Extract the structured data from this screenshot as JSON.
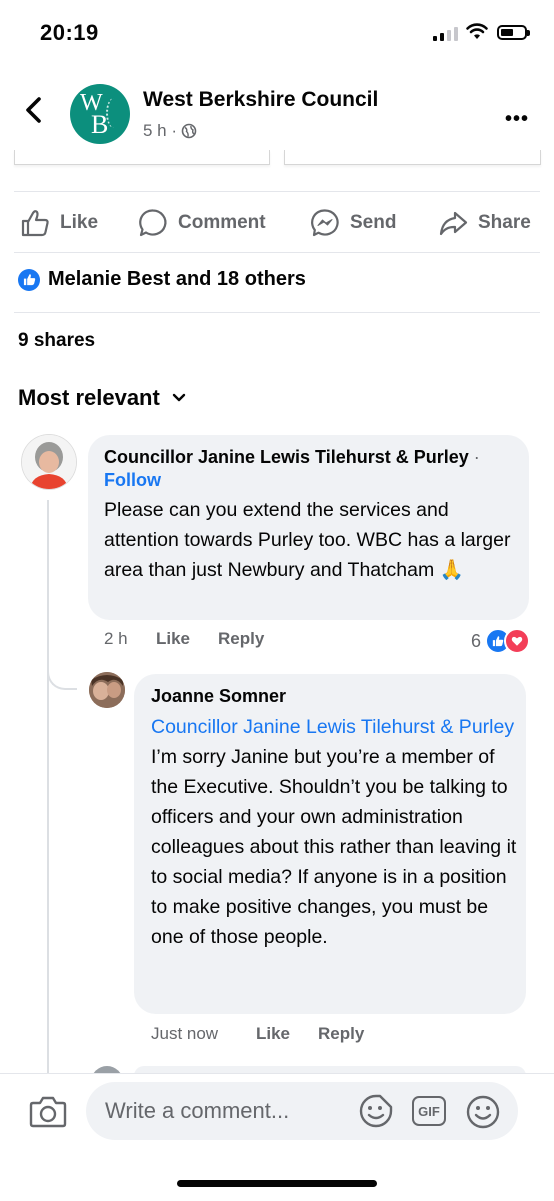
{
  "status": {
    "time": "20:19"
  },
  "header": {
    "page_name": "West Berkshire Council",
    "post_time": "5 h ·",
    "logo_letters": "WB"
  },
  "actions": {
    "like": "Like",
    "comment": "Comment",
    "send": "Send",
    "share": "Share"
  },
  "reactions_summary": "Melanie Best and 18 others",
  "shares": "9 shares",
  "sort_label": "Most relevant",
  "comments": [
    {
      "author": "Councillor Janine Lewis Tilehurst & Purley",
      "dot": "·",
      "follow": "Follow",
      "text": "Please can you extend the services and attention towards Purley too. WBC has a larger area than just Newbury and Thatcham 🙏",
      "time": "2 h",
      "like": "Like",
      "reply": "Reply",
      "reaction_count": "6"
    },
    {
      "author": "Joanne Somner",
      "mention": "Councillor Janine Lewis Tilehurst & Purley",
      "text": " I’m sorry Janine but you’re a member of the Executive. Shouldn’t you be talking to officers and your own administration colleagues about this rather than leaving it to social media? If anyone is in a position to make positive changes, you must be one of those people.",
      "time": "Just now",
      "like": "Like",
      "reply": "Reply"
    }
  ],
  "composer": {
    "placeholder": "Write a comment...",
    "gif": "GIF"
  },
  "colors": {
    "brand_blue": "#1877f2",
    "logo_teal": "#0c8f7d",
    "love_red": "#f33e58",
    "muted": "#65676b"
  },
  "icons": [
    "back-arrow-icon",
    "globe-icon",
    "more-icon",
    "like-icon",
    "comment-icon",
    "messenger-icon",
    "share-icon",
    "chevron-down-icon",
    "camera-icon",
    "sticker-icon",
    "gif-icon",
    "emoji-icon"
  ]
}
